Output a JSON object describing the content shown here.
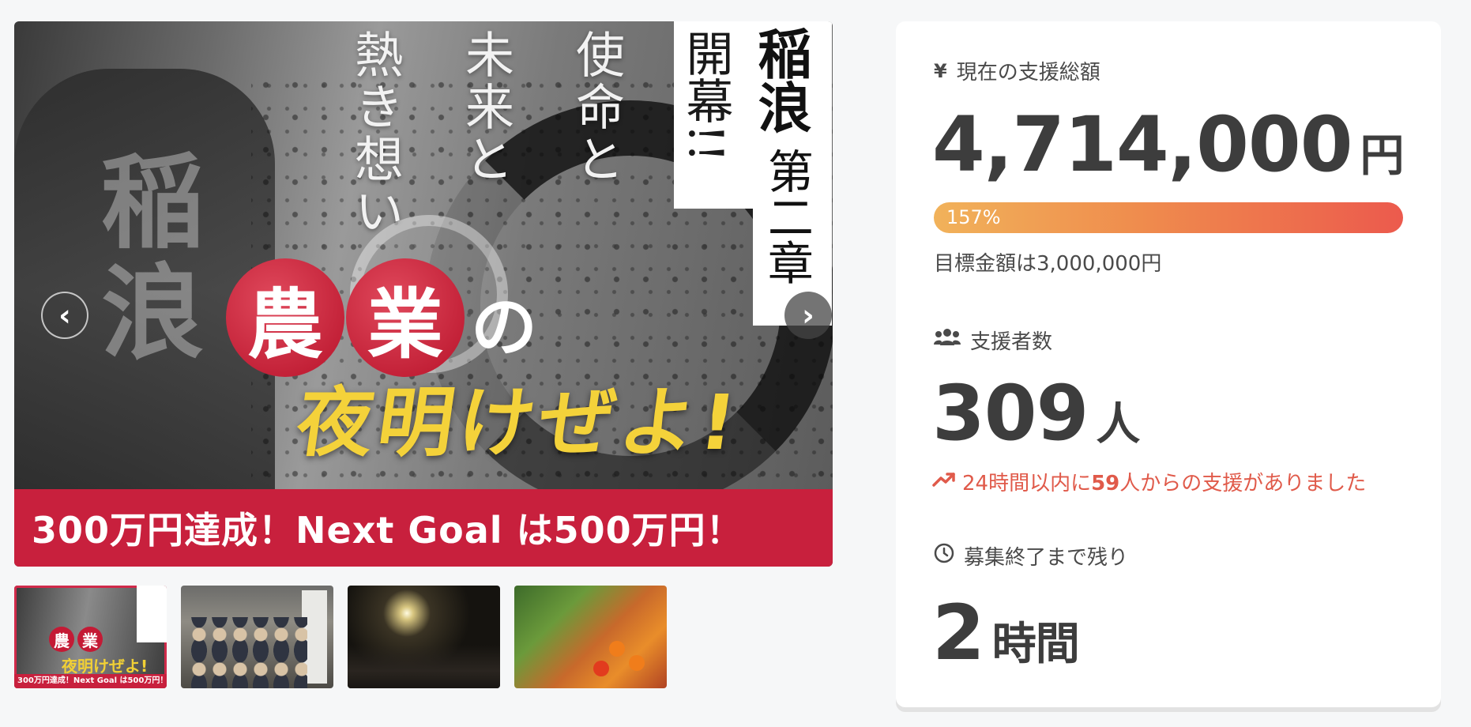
{
  "gallery": {
    "hero": {
      "vertical_lines": [
        "使命と",
        "未来と",
        "熱き想い"
      ],
      "title_card": {
        "kaimaku": "開幕!!",
        "brand": "稲浪",
        "chapter": "第二章"
      },
      "jacket_text": "稲浪",
      "headline_balls": [
        "農",
        "業"
      ],
      "headline_tail": "の",
      "headline_main": "夜明けぜよ!",
      "banner": "300万円達成！Next  Goal は500万円！"
    },
    "prev_label": "‹",
    "next_label": "›",
    "thumbnails": [
      {
        "name": "thumbnail-1",
        "active": true,
        "banner": "300万円達成！Next Goal は500万円！"
      },
      {
        "name": "thumbnail-2",
        "active": false
      },
      {
        "name": "thumbnail-3",
        "active": false
      },
      {
        "name": "thumbnail-4",
        "active": false
      }
    ]
  },
  "stats": {
    "amount": {
      "icon": "yen-icon",
      "icon_glyph": "¥",
      "label": "現在の支援総額",
      "value": "4,714,000",
      "unit": "円"
    },
    "progress": {
      "percent_label": "157%",
      "percent": 157,
      "goal_text": "目標金額は3,000,000円"
    },
    "backers": {
      "icon": "users-icon",
      "label": "支援者数",
      "value": "309",
      "unit": "人",
      "recent_prefix": "24時間以内に",
      "recent_count": "59",
      "recent_suffix": "人からの支援がありました"
    },
    "remaining": {
      "icon": "clock-icon",
      "label": "募集終了まで残り",
      "value": "2",
      "unit": "時間"
    }
  },
  "colors": {
    "banner": "#c8203d",
    "progress_start": "#f1b25a",
    "progress_end": "#ec5a4d",
    "recent_text": "#e05a4a"
  }
}
